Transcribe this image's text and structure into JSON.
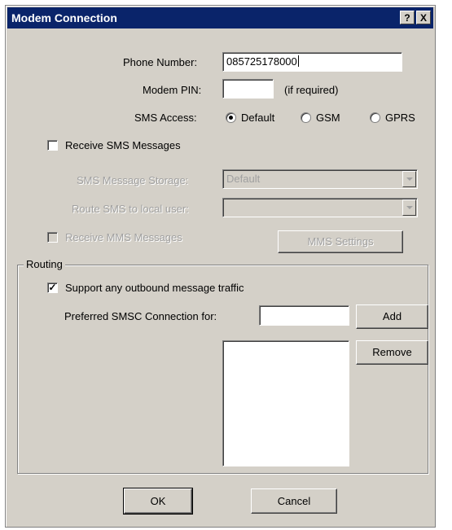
{
  "window": {
    "title": "Modem Connection",
    "help_button": "?",
    "close_button": "X"
  },
  "phone_number": {
    "label": "Phone Number:",
    "value": "085725178000"
  },
  "modem_pin": {
    "label": "Modem PIN:",
    "value": "",
    "hint": "(if required)"
  },
  "sms_access": {
    "label": "SMS Access:",
    "options": [
      "Default",
      "GSM",
      "GPRS"
    ],
    "selected": "Default"
  },
  "receive_sms": {
    "label": "Receive SMS Messages",
    "checked": false
  },
  "sms_storage": {
    "label": "SMS Message Storage:",
    "value": "Default"
  },
  "route_sms": {
    "label": "Route SMS to local user:",
    "value": ""
  },
  "receive_mms": {
    "label": "Receive MMS Messages",
    "checked": false
  },
  "mms_settings_button": "MMS Settings",
  "routing": {
    "legend": "Routing",
    "support_outbound": {
      "label": "Support any outbound message traffic",
      "checked": true,
      "mark": "✓"
    },
    "preferred_smsc": {
      "label": "Preferred SMSC Connection for:",
      "value": ""
    },
    "add_button": "Add",
    "remove_button": "Remove"
  },
  "footer": {
    "ok": "OK",
    "cancel": "Cancel"
  }
}
